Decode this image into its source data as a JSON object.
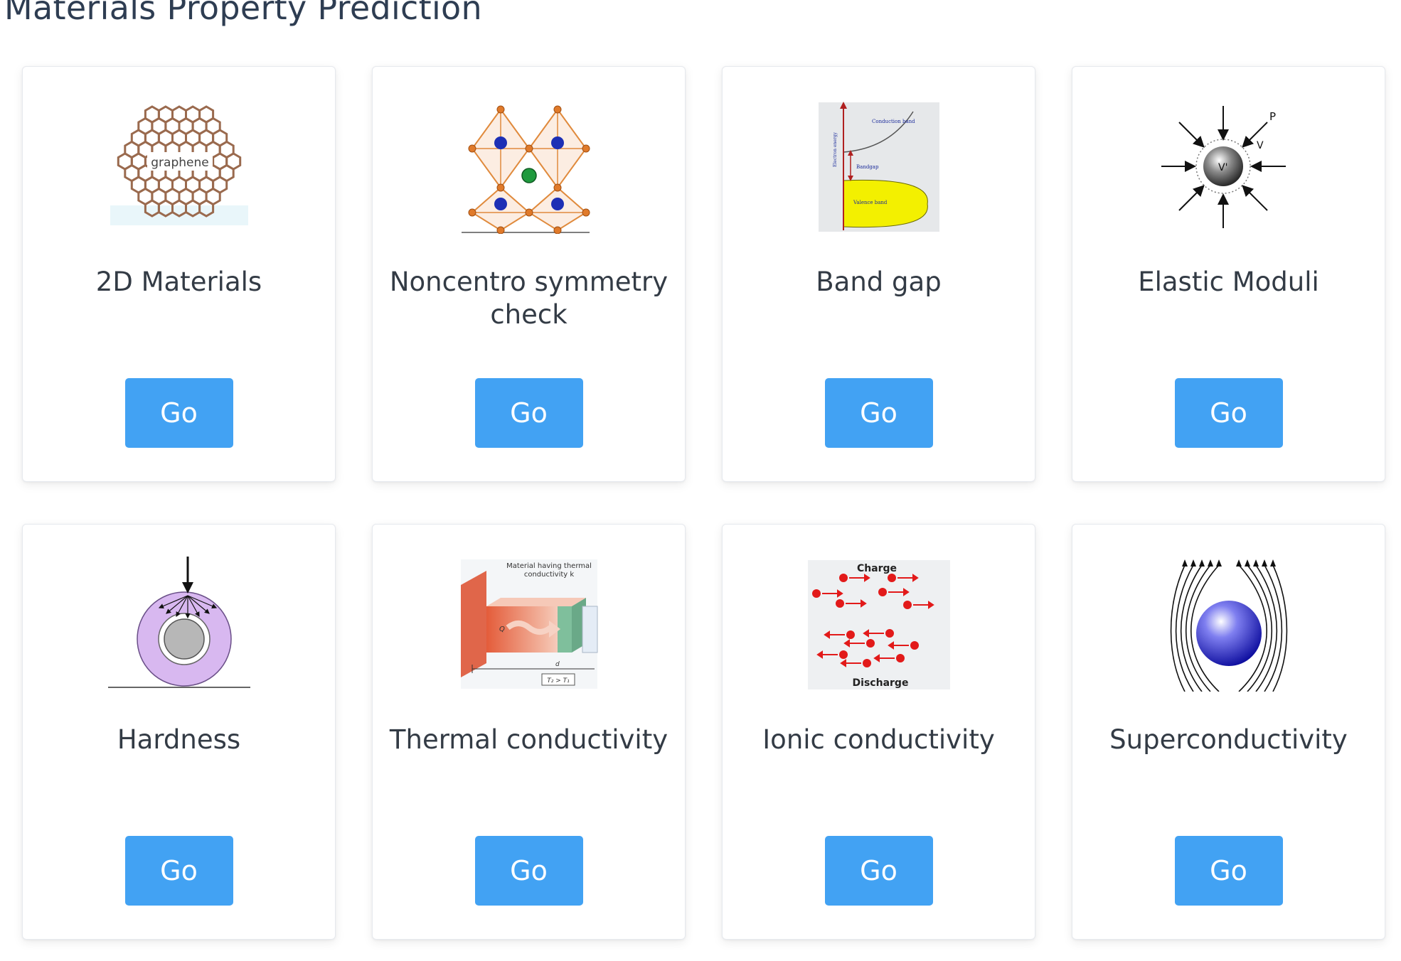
{
  "page": {
    "title": "Materials Property Prediction"
  },
  "theme": {
    "button_color": "#42a2f3",
    "title_color": "#2e3d52"
  },
  "cards": [
    {
      "title": "2D Materials",
      "button_label": "Go",
      "image": "graphene-lattice-icon",
      "image_label": "graphene"
    },
    {
      "title": "Noncentro symmetry check",
      "button_label": "Go",
      "image": "crystal-octahedra-icon"
    },
    {
      "title": "Band gap",
      "button_label": "Go",
      "image": "band-gap-diagram-icon",
      "image_labels": {
        "conduction": "Conduction band",
        "bandgap": "Bandgap",
        "valence": "Valence band",
        "axis": "Electron energy"
      }
    },
    {
      "title": "Elastic Moduli",
      "button_label": "Go",
      "image": "pressure-sphere-icon",
      "image_labels": {
        "p": "P",
        "v": "V",
        "vprime": "V'"
      }
    },
    {
      "title": "Hardness",
      "button_label": "Go",
      "image": "indentation-icon"
    },
    {
      "title": "Thermal conductivity",
      "button_label": "Go",
      "image": "heat-flow-slab-icon",
      "image_labels": {
        "caption": "Material having thermal conductivity k",
        "q": "Q",
        "d": "d",
        "temps": "T₂ > T₁"
      }
    },
    {
      "title": "Ionic conductivity",
      "button_label": "Go",
      "image": "ion-migration-icon",
      "image_labels": {
        "top": "Charge",
        "bottom": "Discharge"
      }
    },
    {
      "title": "Superconductivity",
      "button_label": "Go",
      "image": "meissner-effect-icon"
    }
  ]
}
